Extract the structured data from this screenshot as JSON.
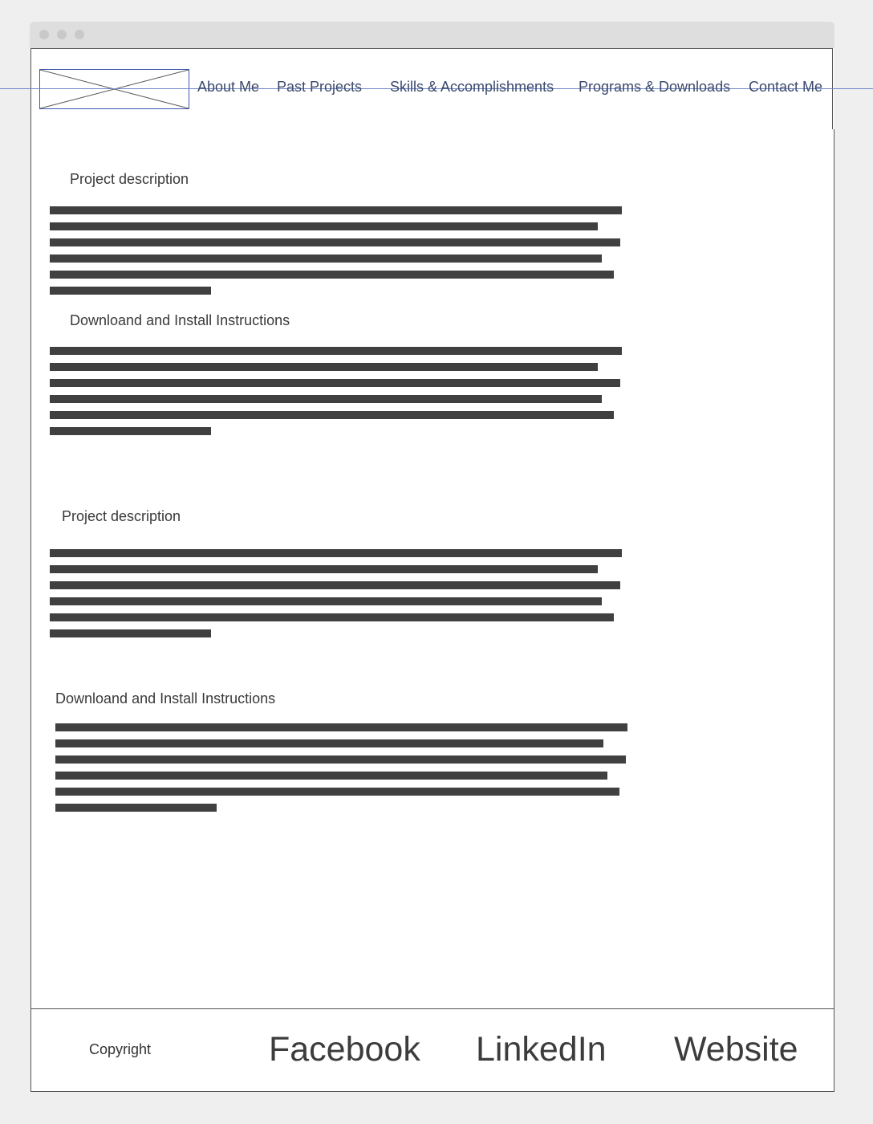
{
  "nav": {
    "items": [
      {
        "label": "About Me"
      },
      {
        "label": "Past Projects"
      },
      {
        "label": "Skills & Accomplishments"
      },
      {
        "label": "Programs & Downloads"
      },
      {
        "label": "Contact Me"
      }
    ]
  },
  "main": {
    "sections": [
      {
        "heading": "Project description"
      },
      {
        "heading": "Downloand and Install Instructions"
      },
      {
        "heading": "Project description"
      },
      {
        "heading": "Downloand and Install Instructions"
      }
    ]
  },
  "footer": {
    "copyright": "Copyright",
    "links": [
      {
        "label": "Facebook"
      },
      {
        "label": "LinkedIn"
      },
      {
        "label": "Website"
      }
    ]
  }
}
